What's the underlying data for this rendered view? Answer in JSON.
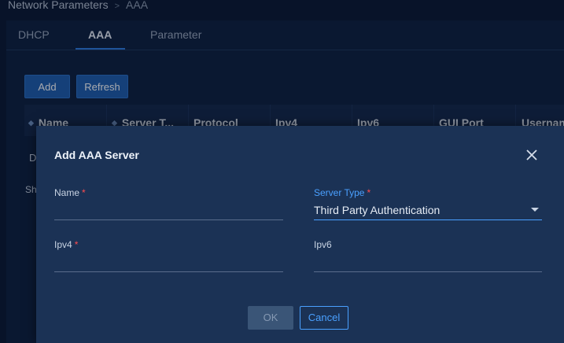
{
  "breadcrumb": {
    "parent": "Network Parameters",
    "separator": ">",
    "current": "AAA"
  },
  "tabs": [
    {
      "label": "DHCP"
    },
    {
      "label": "AAA"
    },
    {
      "label": "Parameter"
    }
  ],
  "toolbar": {
    "add_label": "Add",
    "refresh_label": "Refresh"
  },
  "table": {
    "columns": [
      {
        "label": "Name"
      },
      {
        "label": "Server T..."
      },
      {
        "label": "Protocol"
      },
      {
        "label": "Ipv4"
      },
      {
        "label": "Ipv6"
      },
      {
        "label": "GUI Port"
      },
      {
        "label": "Usernam"
      }
    ],
    "row_fragment": "D",
    "footer_fragment": "Sh"
  },
  "modal": {
    "title": "Add AAA Server",
    "fields": {
      "name": {
        "label": "Name",
        "required": "*",
        "value": ""
      },
      "server_type": {
        "label": "Server Type",
        "required": "*",
        "value": "Third Party Authentication"
      },
      "ipv4": {
        "label": "Ipv4",
        "required": "*",
        "value": ""
      },
      "ipv6": {
        "label": "Ipv6",
        "value": ""
      }
    },
    "ok_label": "OK",
    "cancel_label": "Cancel"
  },
  "colors": {
    "accent": "#4aa0ff",
    "required": "#ff4d4f",
    "primary_button": "#1f5fae"
  }
}
